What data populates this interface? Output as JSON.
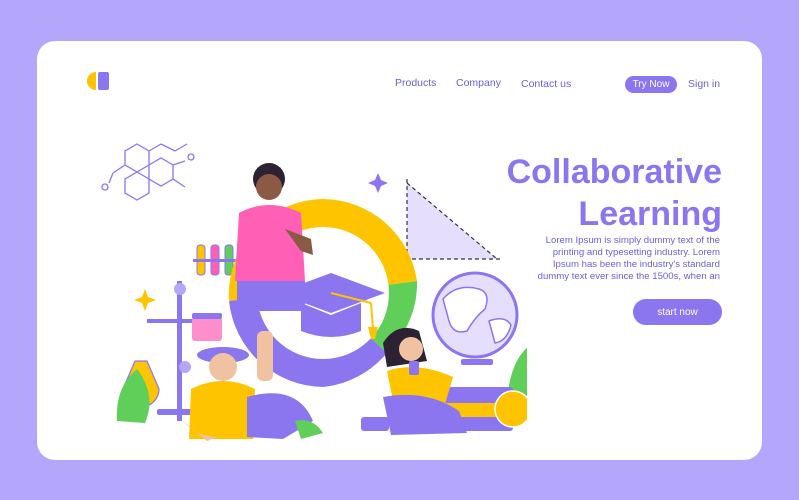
{
  "nav": {
    "products": "Products",
    "company": "Company",
    "contact": "Contact us",
    "try_now": "Try Now",
    "sign_in": "Sign in"
  },
  "hero": {
    "title_line1": "Collaborative",
    "title_line2": "Learning",
    "description": "Lorem Ipsum is simply dummy text of the printing and typesetting industry. Lorem Ipsum has been the industry's standard dummy text ever since the 1500s, when an",
    "cta": "start now"
  },
  "colors": {
    "background": "#b3a6fb",
    "accent": "#8b76ef",
    "nav_text": "#6b5fd9",
    "yellow": "#ffc400",
    "green": "#5fcf5a",
    "pink": "#ff5fb5"
  }
}
